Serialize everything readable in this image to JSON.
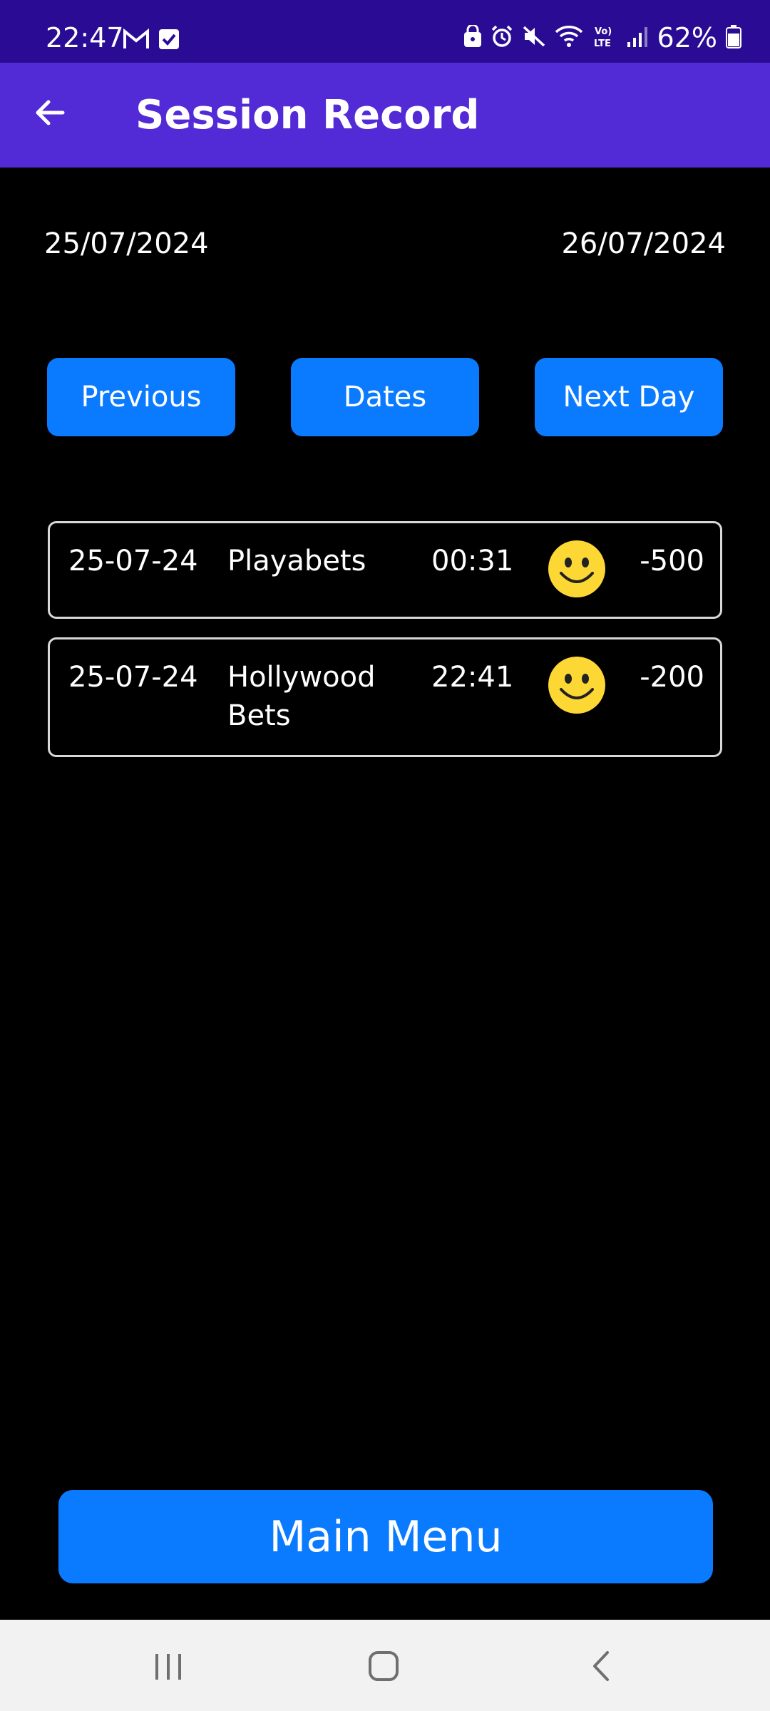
{
  "status_bar": {
    "time": "22:47",
    "battery": "62%",
    "left_icons": [
      "gmail-icon",
      "checkbox-icon"
    ],
    "right_icons": [
      "lock-icon",
      "alarm-icon",
      "mute-icon",
      "wifi-icon",
      "volte-icon",
      "signal-icon",
      "battery-icon"
    ]
  },
  "app_bar": {
    "title": "Session Record",
    "back_icon": "arrow-left-icon"
  },
  "date_range": {
    "start": "25/07/2024",
    "end": "26/07/2024"
  },
  "controls": {
    "previous_label": "Previous",
    "dates_label": "Dates",
    "next_label": "Next Day"
  },
  "records": [
    {
      "date": "25-07-24",
      "name": "Playabets",
      "time": "00:31",
      "mood_icon": "smiley-icon",
      "amount": "-500"
    },
    {
      "date": "25-07-24",
      "name": "Hollywood Bets",
      "time": "22:41",
      "mood_icon": "smiley-icon",
      "amount": "-200"
    }
  ],
  "main_menu_label": "Main Menu",
  "colors": {
    "status_bar_bg": "#2a0c94",
    "app_bar_bg": "#522ad6",
    "button_blue": "#0a7aff",
    "smiley_yellow": "#fdd835",
    "background": "#000000"
  },
  "nav_bar": {
    "icons": [
      "recents-icon",
      "home-icon",
      "back-icon"
    ]
  }
}
